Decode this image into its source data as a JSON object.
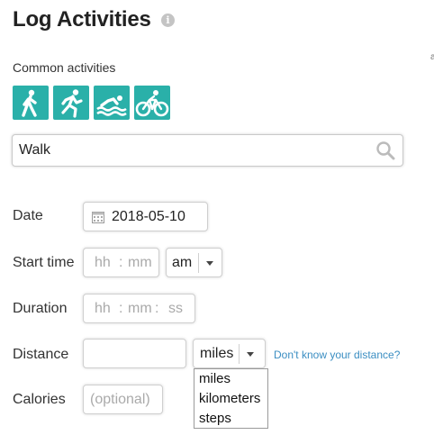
{
  "page": {
    "title": "Log Activities",
    "info_glyph": "i"
  },
  "stray_mark": "a",
  "common_activities": {
    "label": "Common activities",
    "buttons": [
      {
        "icon": "walk-icon"
      },
      {
        "icon": "run-icon"
      },
      {
        "icon": "swim-icon"
      },
      {
        "icon": "bike-icon"
      }
    ]
  },
  "search": {
    "value": "Walk",
    "icon": "search-icon"
  },
  "form": {
    "date": {
      "label": "Date",
      "value": "2018-05-10",
      "icon": "calendar-icon"
    },
    "start_time": {
      "label": "Start time",
      "hh": "hh",
      "sep": ":",
      "mm": "mm",
      "ampm": "am"
    },
    "duration": {
      "label": "Duration",
      "hh": "hh",
      "sep1": ":",
      "mm": "mm",
      "sep2": ":",
      "ss": "ss"
    },
    "distance": {
      "label": "Distance",
      "value": "",
      "unit": "miles",
      "link": "Don't know your distance?",
      "options": [
        "miles",
        "kilometers",
        "steps"
      ]
    },
    "calories": {
      "label": "Calories",
      "placeholder": "(optional)"
    }
  },
  "colors": {
    "accent": "#2ab0a9",
    "link": "#3b8ec2"
  }
}
